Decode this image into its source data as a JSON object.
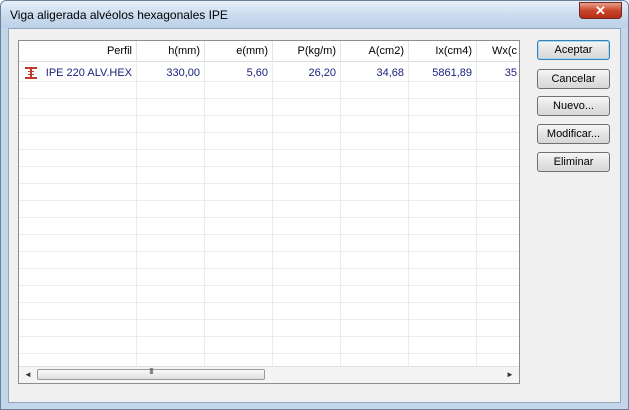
{
  "window": {
    "title": "Viga aligerada alvéolos hexagonales IPE"
  },
  "table": {
    "columns": [
      "Perfil",
      "h(mm)",
      "e(mm)",
      "P(kg/m)",
      "A(cm2)",
      "Ix(cm4)",
      "Wx(c"
    ],
    "rows": [
      {
        "icon": "i-beam-profile-icon",
        "cells": [
          "IPE 220 ALV.HEX",
          "330,00",
          "5,60",
          "26,20",
          "34,68",
          "5861,89",
          "35"
        ]
      }
    ],
    "scrollbar": {
      "grip": "III",
      "left_arrow": "◄",
      "right_arrow": "►"
    }
  },
  "buttons": {
    "accept": "Aceptar",
    "cancel": "Cancelar",
    "new": "Nuevo...",
    "modify": "Modificar...",
    "delete": "Eliminar"
  },
  "close": "✕",
  "colors": {
    "data_text": "#1a237e",
    "title_bg": "#c9dbee",
    "close": "#c9452c"
  }
}
